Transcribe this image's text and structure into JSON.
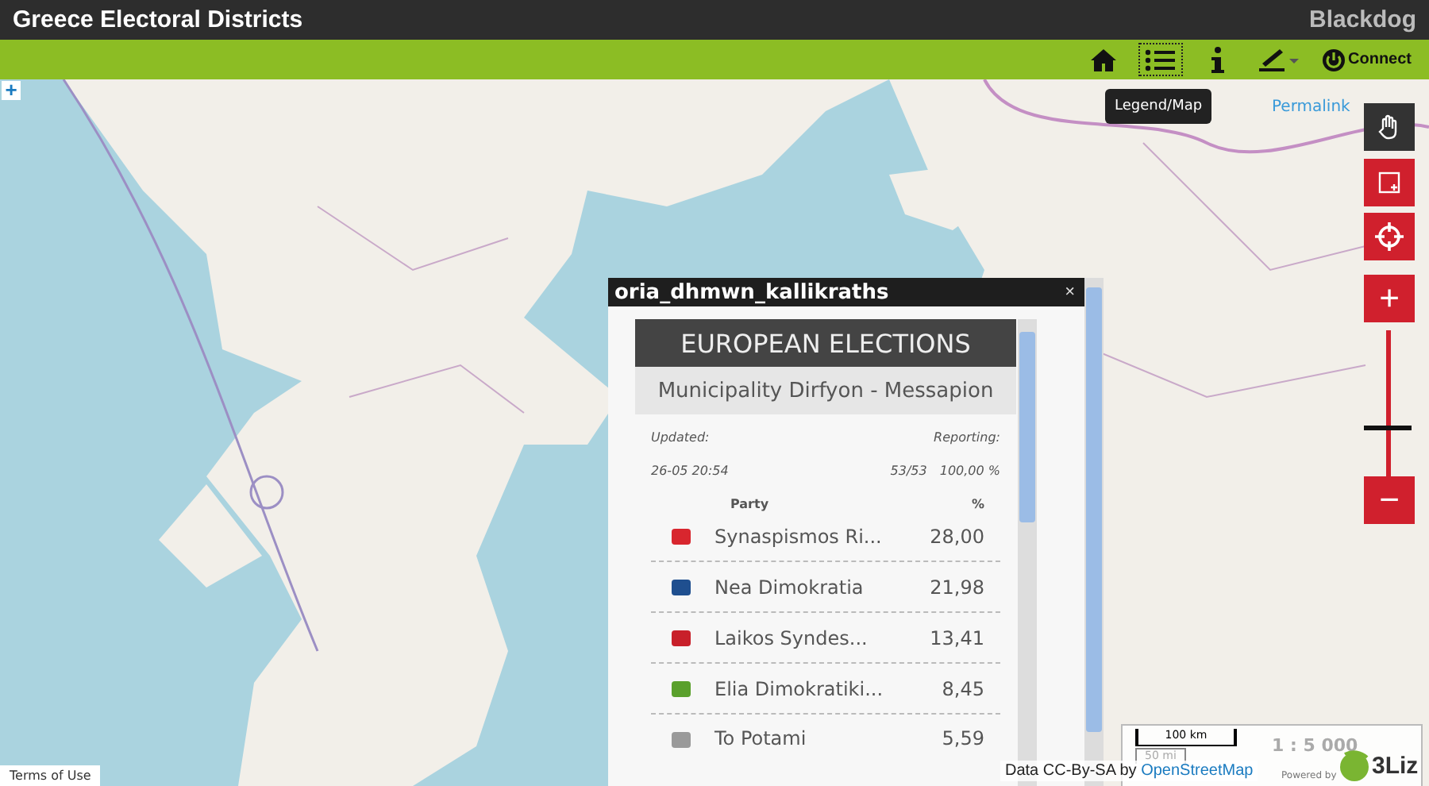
{
  "header": {
    "title": "Greece Electoral Districts",
    "brand": "Blackdog"
  },
  "toolbar": {
    "items": [
      {
        "kind": "home",
        "selected": false
      },
      {
        "kind": "legend",
        "selected": true
      },
      {
        "kind": "info",
        "selected": false
      },
      {
        "kind": "edit",
        "selected": false
      },
      {
        "kind": "connect",
        "selected": false,
        "label": "Connect"
      }
    ],
    "tooltip": "Legend/Map"
  },
  "map": {
    "expand": "+",
    "permalink": "Permalink",
    "terms": "Terms of Use",
    "attribution": "Data CC-By-SA by",
    "attribution_link": "OpenStreetMap",
    "scale": {
      "bar": "100 km",
      "bar2": "50 mi",
      "ratio": "1 : 5 000"
    },
    "powered_by": "Powered by",
    "logo": "3Liz"
  },
  "controls": {
    "pan_selected": true,
    "zoom": {
      "in": "+",
      "out": "−",
      "level": 0.35
    }
  },
  "popup": {
    "title": "oria_dhmwn_kallikraths",
    "close": "×",
    "heading": "EUROPEAN ELECTIONS",
    "subheading": "Municipality Dirfyon - Messapion",
    "updated_label": "Updated:",
    "reporting_label": "Reporting:",
    "updated": "26-05 20:54",
    "reporting_count": "53/53",
    "reporting_pct": "100,00 %",
    "columns": [
      "Party",
      "%"
    ],
    "rows": [
      {
        "party": "Synaspismos Ri...",
        "pct": "28,00",
        "color": "#d8262e"
      },
      {
        "party": "Nea Dimokratia",
        "pct": "21,98",
        "color": "#1f4f8f"
      },
      {
        "party": "Laikos Syndes...",
        "pct": "13,41",
        "color": "#c8202a"
      },
      {
        "party": "Elia Dimokratiki...",
        "pct": "8,45",
        "color": "#5aa02c"
      },
      {
        "party": "To Potami",
        "pct": "5,59",
        "color": "#9a9a9a"
      }
    ]
  }
}
